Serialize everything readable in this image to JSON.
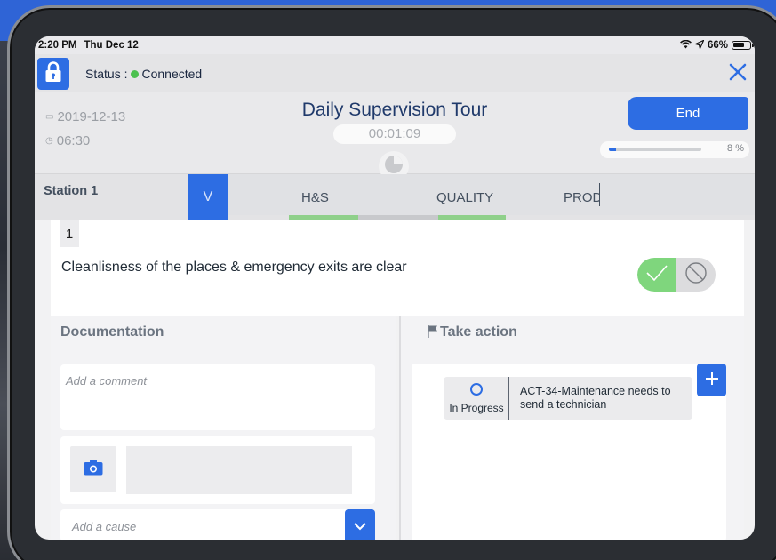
{
  "status_bar": {
    "time": "2:20 PM",
    "date": "Thu Dec 12",
    "battery": "66%"
  },
  "connection": {
    "label": "Status :",
    "state": "Connected",
    "state_color": "#4cc14f"
  },
  "header": {
    "date": "2019-12-13",
    "time": "06:30",
    "title": "Daily Supervision Tour",
    "timer": "00:01:09",
    "end_label": "End",
    "progress_percent": 8,
    "progress_label": "8 %"
  },
  "station": {
    "label": "Station 1",
    "toggle_glyph": "V"
  },
  "tabs": [
    {
      "label": "H&S",
      "strip_color": "#8fd08a"
    },
    {
      "label": "QUALITY",
      "strip_color": "#8fd08a"
    },
    {
      "label": "PROD",
      "strip_color": "#c8c9cc"
    }
  ],
  "question": {
    "number": "1",
    "text": "Cleanlisness of the places & emergency exits are clear",
    "answer": "yes"
  },
  "documentation": {
    "title": "Documentation",
    "comment_placeholder": "Add a comment",
    "cause_placeholder": "Add a cause"
  },
  "take_action": {
    "title": "Take action",
    "items": [
      {
        "status": "In Progress",
        "text": "ACT-34-Maintenance needs to send a technician"
      }
    ]
  },
  "colors": {
    "accent": "#2d6de3",
    "title": "#203a6b",
    "yes_green": "#7fd67d"
  }
}
